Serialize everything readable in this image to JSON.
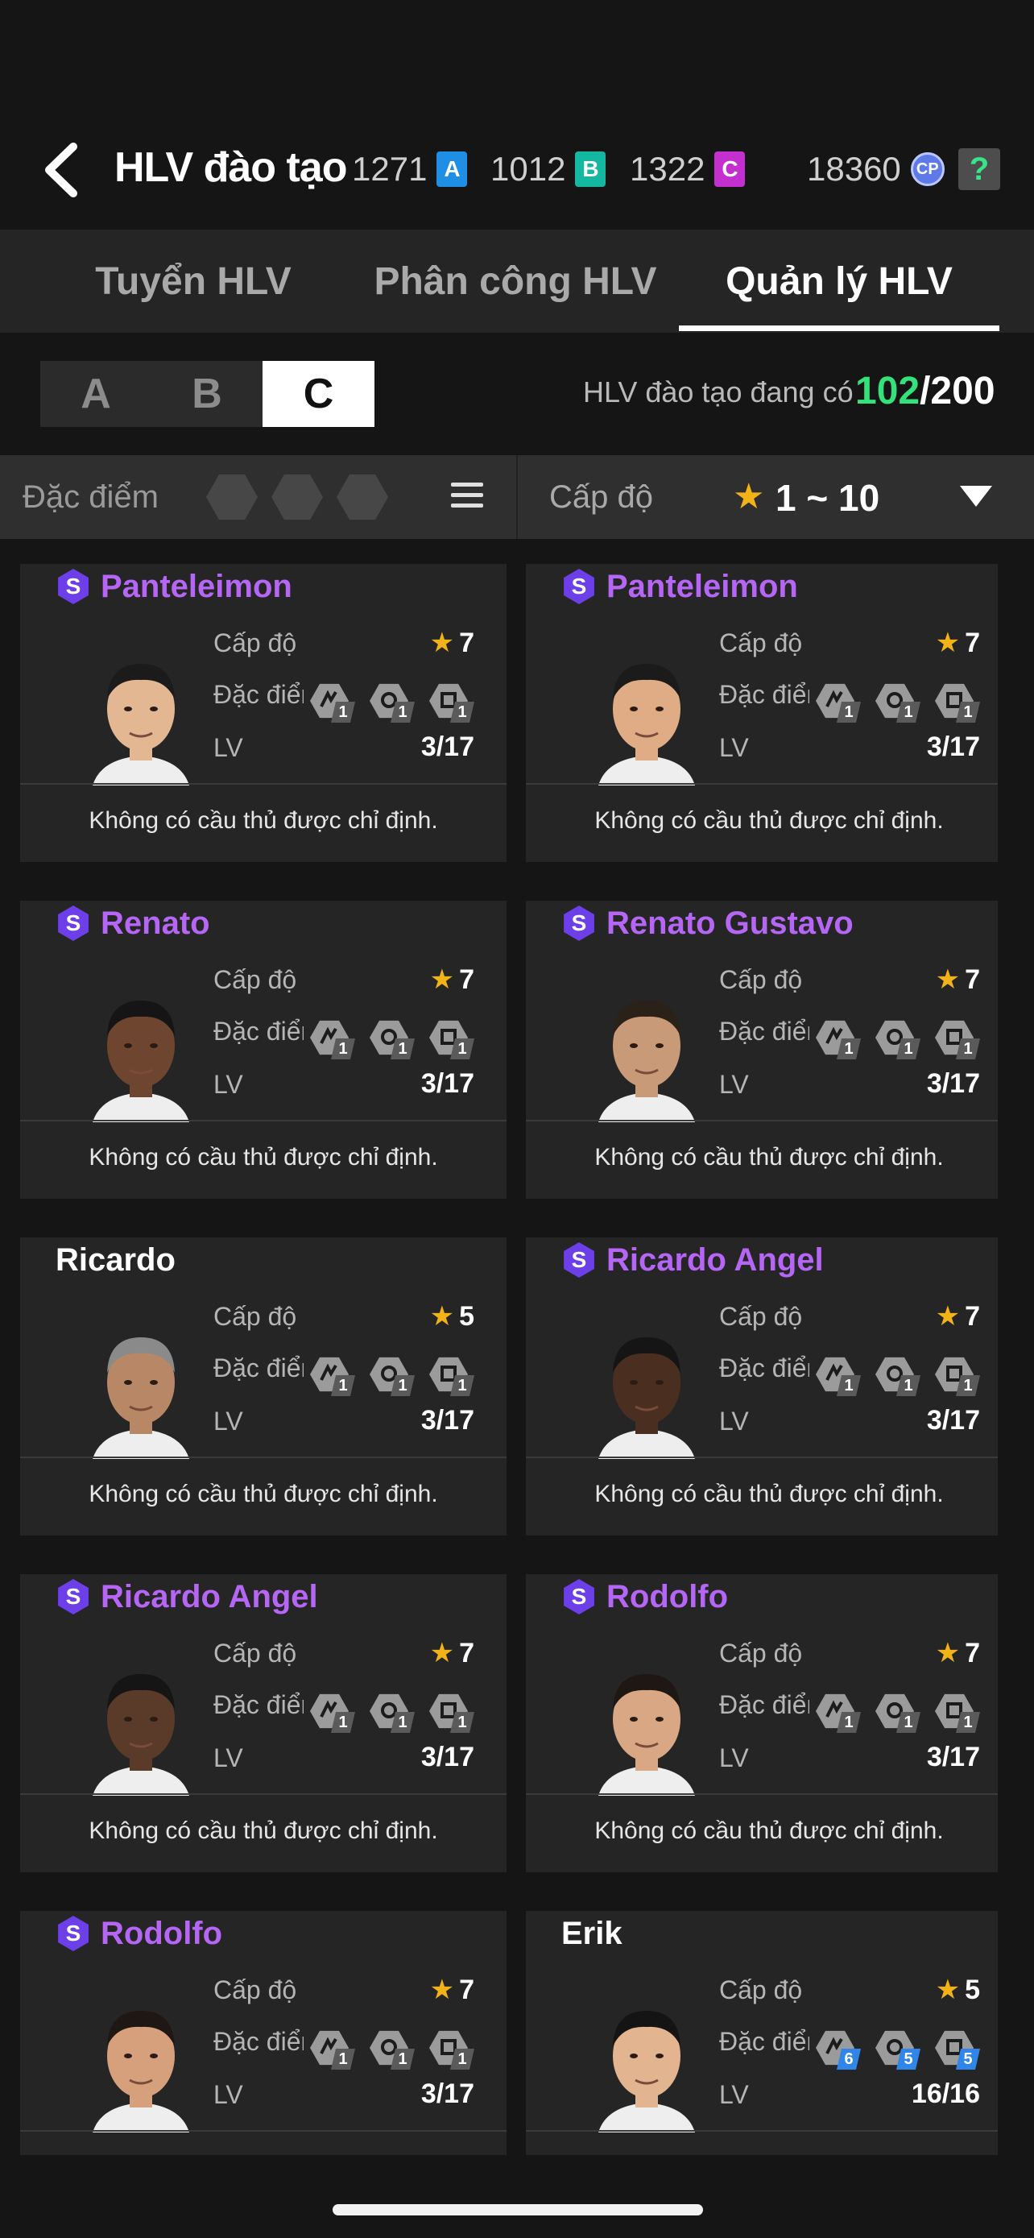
{
  "header": {
    "title": "HLV đào tạo",
    "currencies": [
      {
        "value": "1271",
        "chip": "A",
        "color": "#1f8fe6"
      },
      {
        "value": "1012",
        "chip": "B",
        "color": "#14b8a0"
      },
      {
        "value": "1322",
        "chip": "C",
        "color": "#c42fcf"
      }
    ],
    "cp_value": "18360",
    "cp_label": "CP",
    "help_label": "?"
  },
  "tabs": [
    "Tuyển HLV",
    "Phân công  HLV",
    "Quản lý HLV"
  ],
  "active_tab": "Quản lý HLV",
  "grades": [
    "A",
    "B",
    "C"
  ],
  "active_grade": "C",
  "coach_count": {
    "label": "HLV đào tạo đang có",
    "current": "102",
    "max": "/200"
  },
  "filter": {
    "trait_label": "Đặc điểm c",
    "level_label": "Cấp độ",
    "level_star": "★",
    "level_range": "1 ~ 10"
  },
  "labels": {
    "level": "Cấp độ",
    "traits": "Đặc điểm",
    "lv": "LV"
  },
  "cards": [
    {
      "name": "Panteleimon",
      "special": true,
      "stars": "7",
      "lv": "3/17",
      "trait_nums": [
        "1",
        "1",
        "1"
      ],
      "footer": "Không có cầu thủ được chỉ định."
    },
    {
      "name": "Panteleimon",
      "special": true,
      "stars": "7",
      "lv": "3/17",
      "trait_nums": [
        "1",
        "1",
        "1"
      ],
      "footer": "Không có cầu thủ được chỉ định."
    },
    {
      "name": "Renato",
      "special": true,
      "stars": "7",
      "lv": "3/17",
      "trait_nums": [
        "1",
        "1",
        "1"
      ],
      "footer": "Không có cầu thủ được chỉ định."
    },
    {
      "name": "Renato Gustavo",
      "special": true,
      "stars": "7",
      "lv": "3/17",
      "trait_nums": [
        "1",
        "1",
        "1"
      ],
      "footer": "Không có cầu thủ được chỉ định."
    },
    {
      "name": "Ricardo",
      "special": false,
      "stars": "5",
      "lv": "3/17",
      "trait_nums": [
        "1",
        "1",
        "1"
      ],
      "footer": "Không có cầu thủ được chỉ định."
    },
    {
      "name": "Ricardo Angel",
      "special": true,
      "stars": "7",
      "lv": "3/17",
      "trait_nums": [
        "1",
        "1",
        "1"
      ],
      "footer": "Không có cầu thủ được chỉ định."
    },
    {
      "name": "Ricardo Angel",
      "special": true,
      "stars": "7",
      "lv": "3/17",
      "trait_nums": [
        "1",
        "1",
        "1"
      ],
      "footer": "Không có cầu thủ được chỉ định."
    },
    {
      "name": "Rodolfo",
      "special": true,
      "stars": "7",
      "lv": "3/17",
      "trait_nums": [
        "1",
        "1",
        "1"
      ],
      "footer": "Không có cầu thủ được chỉ định."
    },
    {
      "name": "Rodolfo",
      "special": true,
      "stars": "7",
      "lv": "3/17",
      "trait_nums": [
        "1",
        "1",
        "1"
      ],
      "footer": ""
    },
    {
      "name": "Erik",
      "special": false,
      "stars": "5",
      "lv": "16/16",
      "trait_nums": [
        "6",
        "5",
        "5"
      ],
      "trait_blue": true,
      "footer": ""
    }
  ],
  "special_badge": "S",
  "colors": {
    "accent_green": "#33e27a",
    "special_purple": "#b566f5",
    "star_gold": "#f2b318"
  }
}
